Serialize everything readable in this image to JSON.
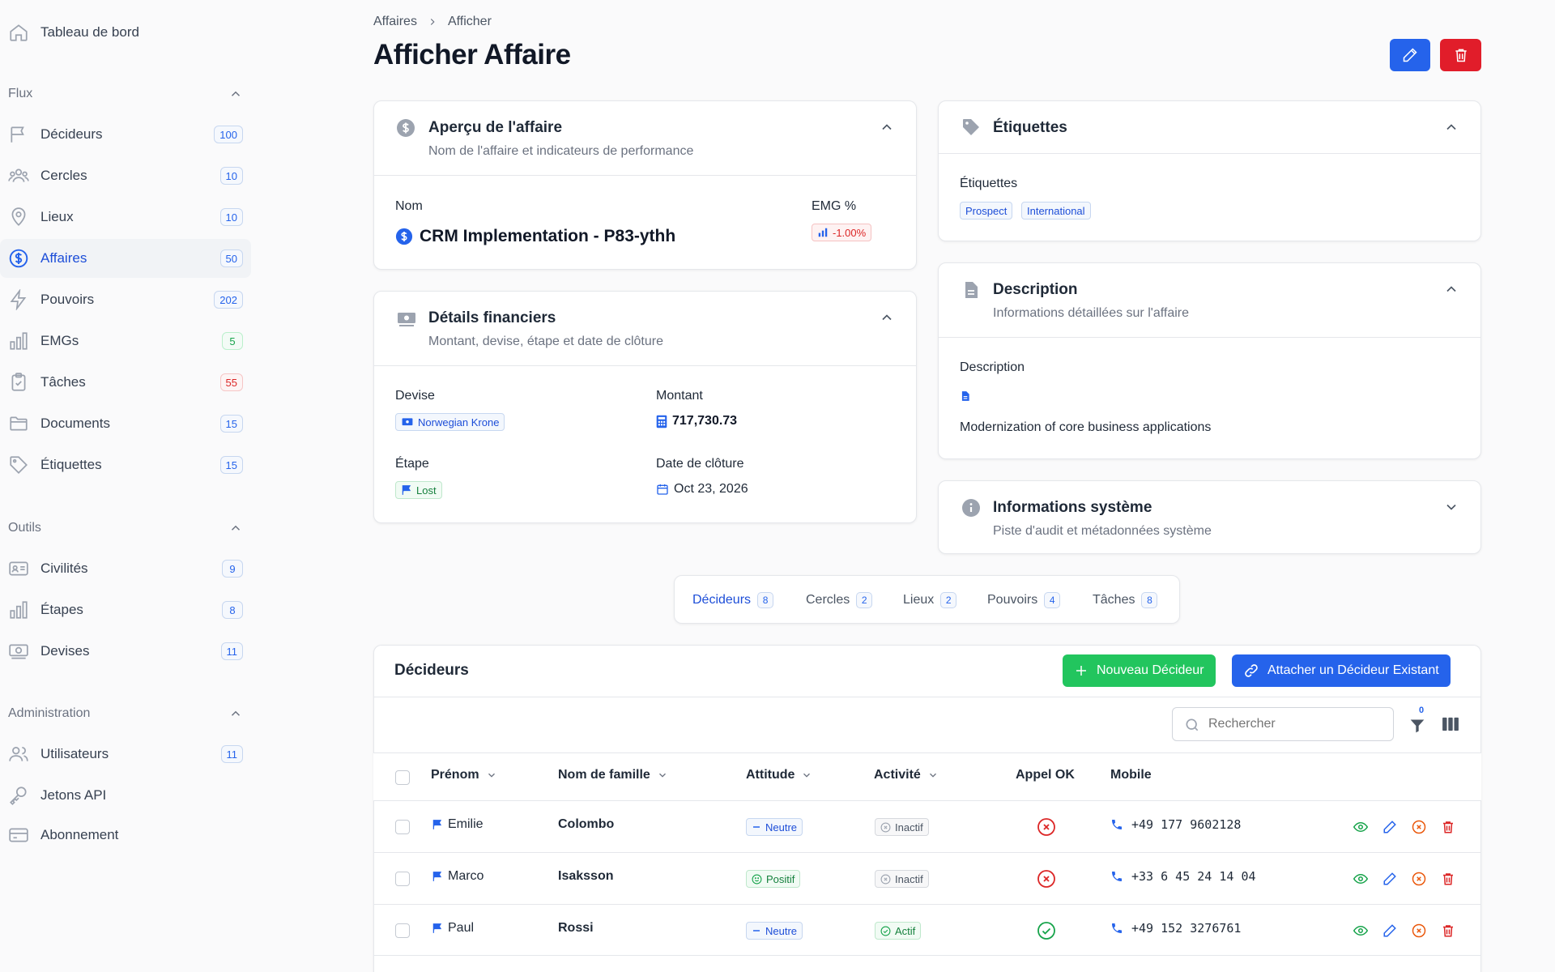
{
  "sidebar": {
    "dashboard": "Tableau de bord",
    "groups": {
      "flux": "Flux",
      "outils": "Outils",
      "admin": "Administration"
    },
    "flux_items": [
      {
        "label": "Décideurs",
        "count": "100"
      },
      {
        "label": "Cercles",
        "count": "10"
      },
      {
        "label": "Lieux",
        "count": "10"
      },
      {
        "label": "Affaires",
        "count": "50"
      },
      {
        "label": "Pouvoirs",
        "count": "202"
      },
      {
        "label": "EMGs",
        "count": "5"
      },
      {
        "label": "Tâches",
        "count": "55"
      },
      {
        "label": "Documents",
        "count": "15"
      },
      {
        "label": "Étiquettes",
        "count": "15"
      }
    ],
    "outils_items": [
      {
        "label": "Civilités",
        "count": "9"
      },
      {
        "label": "Étapes",
        "count": "8"
      },
      {
        "label": "Devises",
        "count": "11"
      }
    ],
    "admin_items": [
      {
        "label": "Utilisateurs",
        "count": "11"
      },
      {
        "label": "Jetons API"
      },
      {
        "label": "Abonnement"
      }
    ]
  },
  "breadcrumb": {
    "parent": "Affaires",
    "current": "Afficher"
  },
  "page_title": "Afficher Affaire",
  "overview": {
    "title": "Aperçu de l'affaire",
    "subtitle": "Nom de l'affaire et indicateurs de performance",
    "name_label": "Nom",
    "name_value": "CRM Implementation - P83-ythh",
    "emg_label": "EMG %",
    "emg_value": "-1.00%"
  },
  "financial": {
    "title": "Détails financiers",
    "subtitle": "Montant, devise, étape et date de clôture",
    "currency_label": "Devise",
    "currency_value": "Norwegian Krone",
    "amount_label": "Montant",
    "amount_value": "717,730.73",
    "stage_label": "Étape",
    "stage_value": "Lost",
    "close_label": "Date de clôture",
    "close_value": "Oct 23, 2026"
  },
  "tags": {
    "title": "Étiquettes",
    "field_label": "Étiquettes",
    "items": [
      "Prospect",
      "International"
    ]
  },
  "description": {
    "title": "Description",
    "subtitle": "Informations détaillées sur l'affaire",
    "field_label": "Description",
    "text": "Modernization of core business applications"
  },
  "system": {
    "title": "Informations système",
    "subtitle": "Piste d'audit et métadonnées système"
  },
  "tabs": [
    {
      "label": "Décideurs",
      "count": "8"
    },
    {
      "label": "Cercles",
      "count": "2"
    },
    {
      "label": "Lieux",
      "count": "2"
    },
    {
      "label": "Pouvoirs",
      "count": "4"
    },
    {
      "label": "Tâches",
      "count": "8"
    }
  ],
  "table": {
    "title": "Décideurs",
    "new_button": "Nouveau Décideur",
    "attach_button": "Attacher un Décideur Existant",
    "search_placeholder": "Rechercher",
    "filter_count": "0",
    "columns": [
      "Prénom",
      "Nom de famille",
      "Attitude",
      "Activité",
      "Appel OK",
      "Mobile"
    ],
    "rows": [
      {
        "first": "Emilie",
        "last": "Colombo",
        "attitude": "Neutre",
        "activity": "Inactif",
        "call_ok": false,
        "mobile": "+49 177 9602128"
      },
      {
        "first": "Marco",
        "last": "Isaksson",
        "attitude": "Positif",
        "activity": "Inactif",
        "call_ok": false,
        "mobile": "+33 6 45 24 14 04"
      },
      {
        "first": "Paul",
        "last": "Rossi",
        "attitude": "Neutre",
        "activity": "Actif",
        "call_ok": true,
        "mobile": "+49 152 3276761"
      }
    ]
  },
  "colors": {
    "primary": "#2563eb",
    "danger": "#e11d2a",
    "success": "#22c55e"
  }
}
